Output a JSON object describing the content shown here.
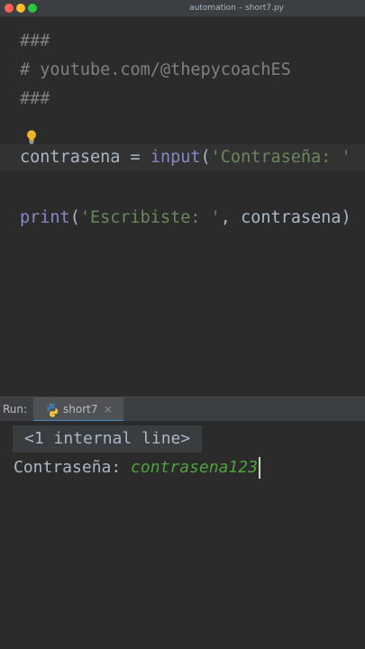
{
  "window": {
    "title": "automation – short7.py"
  },
  "editor": {
    "lines": {
      "l1": "###",
      "l2": "# youtube.com/@thepycoachES",
      "l3": "###",
      "l4": {
        "var": "contrasena",
        "op": " = ",
        "func": "input",
        "open": "(",
        "str": "'Contraseña: '"
      },
      "l5": {
        "func": "print",
        "open": "(",
        "str": "'Escribiste: '",
        "comma": ", ",
        "var": "contrasena",
        "close": ")"
      }
    }
  },
  "toolwindow": {
    "run_label": "Run:",
    "tab": {
      "label": "short7",
      "close": "×"
    }
  },
  "console": {
    "fold_label": "<1 internal line>",
    "prompt": "Contraseña: ",
    "input_value": "contrasena123"
  },
  "colors": {
    "background": "#2b2b2b",
    "comment": "#808080",
    "builtin": "#8888c6",
    "string": "#6a8759",
    "user_input": "#4fa33b",
    "tab_underline": "#4a88c7"
  }
}
